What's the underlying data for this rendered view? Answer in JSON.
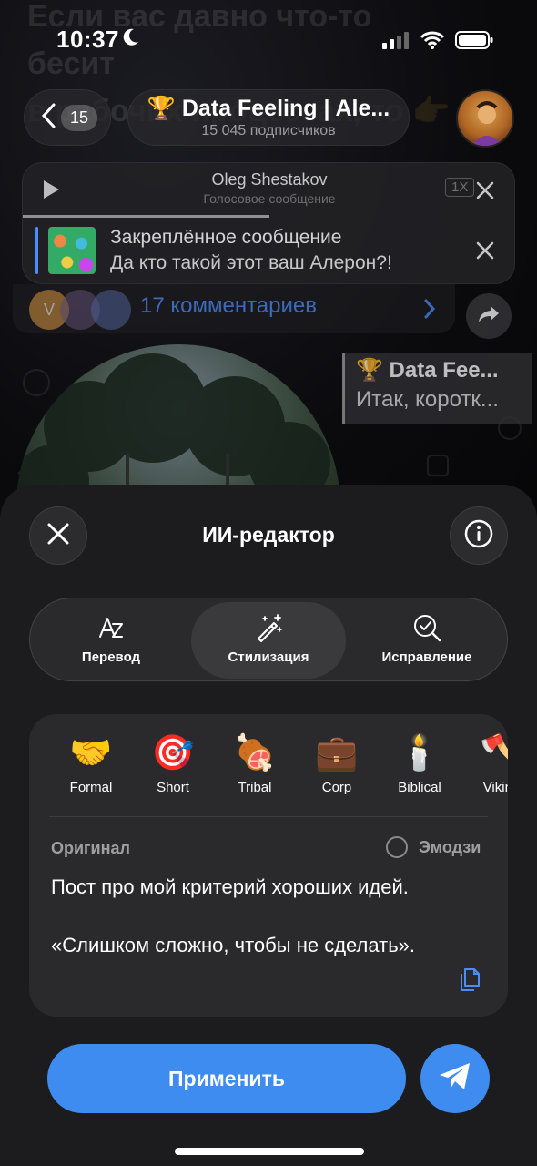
{
  "status": {
    "time": "10:37"
  },
  "header": {
    "back_count": "15",
    "channel_title": "🏆 Data Feeling | Ale...",
    "subscribers": "15 045 подписчиков"
  },
  "voice": {
    "sender": "Oleg Shestakov",
    "subtitle": "Голосовое сообщение",
    "speed": "1X",
    "progress": 0.5
  },
  "pinned": {
    "title": "Закреплённое сообщение",
    "text": "Да кто такой этот ваш Алерон?!"
  },
  "chat": {
    "comments": "17 комментариев",
    "avatar_letter": "V",
    "reply_title": "🏆 Data Fee...",
    "reply_text": "Итак, коротк..."
  },
  "sheet": {
    "title": "ИИ-редактор",
    "tabs": [
      {
        "label": "Перевод",
        "icon": "translate-icon",
        "active": false
      },
      {
        "label": "Стилизация",
        "icon": "magic-wand-icon",
        "active": true
      },
      {
        "label": "Исправление",
        "icon": "search-check-icon",
        "active": false
      }
    ],
    "styles": [
      {
        "emoji": "🤝",
        "label": "Formal"
      },
      {
        "emoji": "🎯",
        "label": "Short"
      },
      {
        "emoji": "🍖",
        "label": "Tribal"
      },
      {
        "emoji": "💼",
        "label": "Corp"
      },
      {
        "emoji": "🕯️",
        "label": "Biblical"
      },
      {
        "emoji": "🪓",
        "label": "Viking"
      }
    ],
    "original_label": "Оригинал",
    "emoji_label": "Эмодзи",
    "original_text": "Пост про мой критерий хороших идей.\n\n«Слишком сложно, чтобы не сделать».",
    "apply_label": "Применить"
  },
  "colors": {
    "accent": "#3e8cf0",
    "sheet_bg": "#1c1c1e",
    "panel_bg": "#2a2a2c"
  }
}
